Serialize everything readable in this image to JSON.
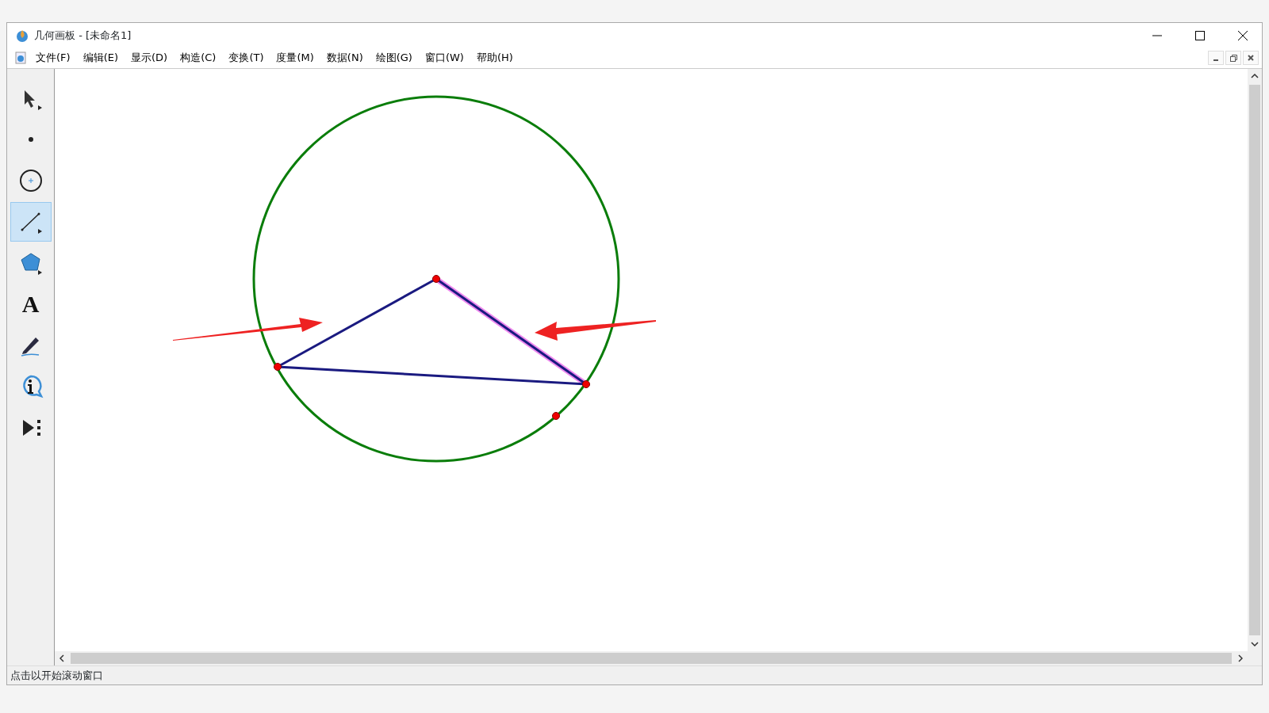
{
  "window": {
    "title": "几何画板 - [未命名1]"
  },
  "menu": [
    {
      "label": "文件(F)"
    },
    {
      "label": "编辑(E)"
    },
    {
      "label": "显示(D)"
    },
    {
      "label": "构造(C)"
    },
    {
      "label": "变换(T)"
    },
    {
      "label": "度量(M)"
    },
    {
      "label": "数据(N)"
    },
    {
      "label": "绘图(G)"
    },
    {
      "label": "窗口(W)"
    },
    {
      "label": "帮助(H)"
    }
  ],
  "toolbox": [
    {
      "kind": "arrow",
      "selected": false
    },
    {
      "kind": "point",
      "selected": false
    },
    {
      "kind": "compass",
      "selected": false
    },
    {
      "kind": "straightedge",
      "selected": true
    },
    {
      "kind": "polygon",
      "selected": false
    },
    {
      "kind": "text",
      "selected": false,
      "label": "A"
    },
    {
      "kind": "marker",
      "selected": false
    },
    {
      "kind": "info",
      "selected": false
    },
    {
      "kind": "custom",
      "selected": false
    }
  ],
  "status_bar": {
    "text": "点击以开始滚动窗口"
  }
}
